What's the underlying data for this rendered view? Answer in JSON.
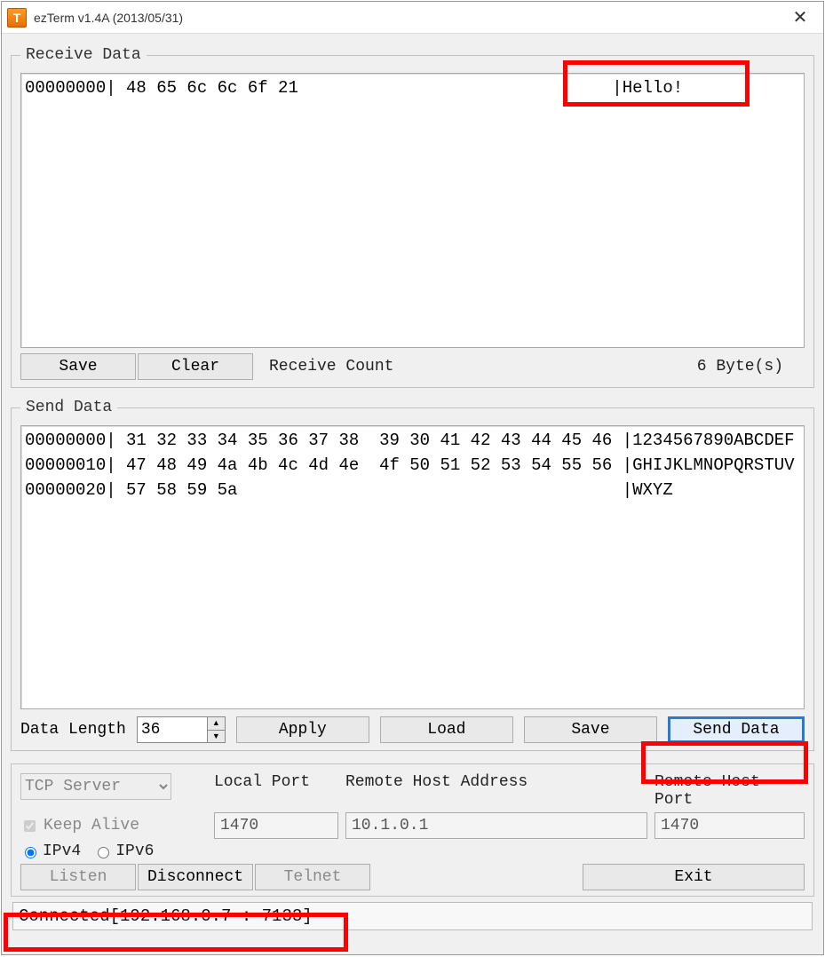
{
  "window": {
    "title": "ezTerm v1.4A (2013/05/31)"
  },
  "receive": {
    "legend": "Receive Data",
    "content": "00000000| 48 65 6c 6c 6f 21                               |Hello!",
    "save_label": "Save",
    "clear_label": "Clear",
    "count_label": "Receive Count",
    "count_value": "6 Byte(s)"
  },
  "send": {
    "legend": "Send Data",
    "content": "00000000| 31 32 33 34 35 36 37 38  39 30 41 42 43 44 45 46 |1234567890ABCDEF\n00000010| 47 48 49 4a 4b 4c 4d 4e  4f 50 51 52 53 54 55 56 |GHIJKLMNOPQRSTUV\n00000020| 57 58 59 5a                                      |WXYZ",
    "length_label": "Data Length",
    "length_value": "36",
    "apply_label": "Apply",
    "load_label": "Load",
    "save_label": "Save",
    "senddata_label": "Send Data"
  },
  "conn": {
    "mode": "TCP Server",
    "keepalive_label": "Keep Alive",
    "ipv4_label": "IPv4",
    "ipv6_label": "IPv6",
    "local_port_label": "Local Port",
    "local_port_value": "1470",
    "remote_host_label": "Remote Host Address",
    "remote_host_value": "10.1.0.1",
    "remote_port_label": "Remote Host Port",
    "remote_port_value": "1470",
    "listen_label": "Listen",
    "disconnect_label": "Disconnect",
    "telnet_label": "Telnet",
    "exit_label": "Exit"
  },
  "status": {
    "text": "Connected[192.168.0.7 : 7133]"
  }
}
